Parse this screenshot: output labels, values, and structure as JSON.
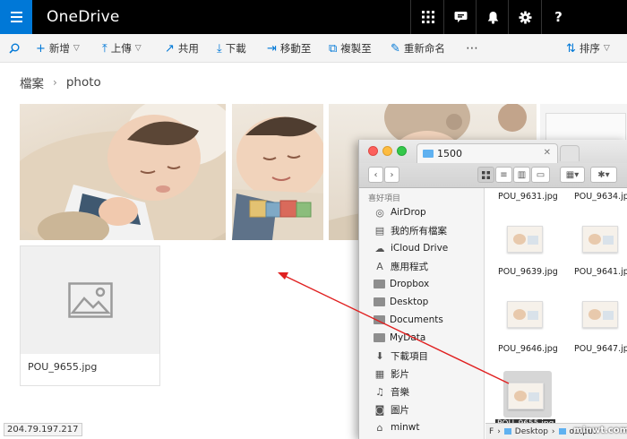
{
  "app": {
    "name": "OneDrive"
  },
  "topbar_icons": [
    "apps-icon",
    "chat-icon",
    "bell-icon",
    "gear-icon",
    "help-icon"
  ],
  "topbar_help": "?",
  "commands": {
    "search_icon": "search-icon",
    "new": "新增",
    "upload": "上傳",
    "share": "共用",
    "download": "下載",
    "move": "移動至",
    "copy": "複製至",
    "rename": "重新命名",
    "more": "⋯",
    "sort": "排序"
  },
  "breadcrumb": {
    "root": "檔案",
    "current": "photo"
  },
  "files": [
    {
      "type": "photo"
    },
    {
      "type": "photo"
    },
    {
      "type": "photo"
    },
    {
      "type": "photo"
    },
    {
      "type": "placeholder",
      "name": "POU_9655.jpg"
    }
  ],
  "status_ip": "204.79.197.217",
  "finder": {
    "tab_title": "1500",
    "sidebar_header": "喜好項目",
    "sidebar_items": [
      "AirDrop",
      "我的所有檔案",
      "iCloud Drive",
      "應用程式",
      "Dropbox",
      "Desktop",
      "Documents",
      "MyData",
      "下載項目",
      "影片",
      "音樂",
      "圖片",
      "minwt"
    ],
    "files": [
      "POU_9631.jpg",
      "POU_9634.jpg",
      "POU_9639.jpg",
      "POU_9641.jpg",
      "POU_9646.jpg",
      "POU_9647.jpg"
    ],
    "drag_label": "POU_9655.jpg",
    "path": [
      "F",
      "Desktop",
      "output"
    ]
  },
  "watermark": "minwt.com",
  "colors": {
    "accent": "#0078d7",
    "topbar": "#000000",
    "arrow": "#e02020"
  }
}
